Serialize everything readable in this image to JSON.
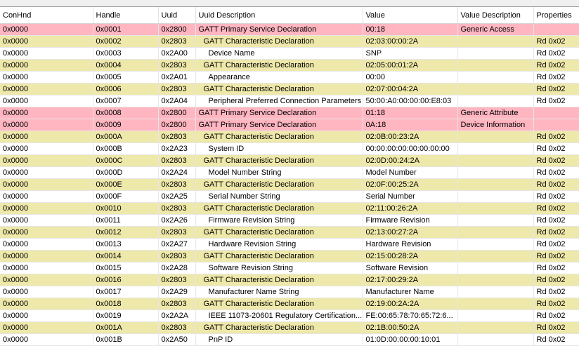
{
  "columns": [
    "ConHnd",
    "Handle",
    "Uuid",
    "Uuid Description",
    "Value",
    "Value Description",
    "Properties"
  ],
  "rows": [
    {
      "kind": "svc",
      "conhnd": "0x0000",
      "handle": "0x0001",
      "uuid": "0x2800",
      "desc": "GATT Primary Service Declaration",
      "value": "00:18",
      "value_desc": "Generic Access",
      "props": ""
    },
    {
      "kind": "chr",
      "conhnd": "0x0000",
      "handle": "0x0002",
      "uuid": "0x2803",
      "desc": "GATT Characteristic Declaration",
      "value": "02:03:00:00:2A",
      "value_desc": "",
      "props": "Rd  0x02"
    },
    {
      "kind": "val",
      "conhnd": "0x0000",
      "handle": "0x0003",
      "uuid": "0x2A00",
      "desc": "Device Name",
      "value": "SNP",
      "value_desc": "",
      "props": "Rd  0x02"
    },
    {
      "kind": "chr",
      "conhnd": "0x0000",
      "handle": "0x0004",
      "uuid": "0x2803",
      "desc": "GATT Characteristic Declaration",
      "value": "02:05:00:01:2A",
      "value_desc": "",
      "props": "Rd  0x02"
    },
    {
      "kind": "val",
      "conhnd": "0x0000",
      "handle": "0x0005",
      "uuid": "0x2A01",
      "desc": "Appearance",
      "value": "00:00",
      "value_desc": "",
      "props": "Rd  0x02"
    },
    {
      "kind": "chr",
      "conhnd": "0x0000",
      "handle": "0x0006",
      "uuid": "0x2803",
      "desc": "GATT Characteristic Declaration",
      "value": "02:07:00:04:2A",
      "value_desc": "",
      "props": "Rd  0x02"
    },
    {
      "kind": "val",
      "conhnd": "0x0000",
      "handle": "0x0007",
      "uuid": "0x2A04",
      "desc": "Peripheral Preferred Connection Parameters",
      "value": "50:00:A0:00:00:00:E8:03",
      "value_desc": "",
      "props": "Rd  0x02"
    },
    {
      "kind": "svc",
      "conhnd": "0x0000",
      "handle": "0x0008",
      "uuid": "0x2800",
      "desc": "GATT Primary Service Declaration",
      "value": "01:18",
      "value_desc": "Generic Attribute",
      "props": ""
    },
    {
      "kind": "svc",
      "conhnd": "0x0000",
      "handle": "0x0009",
      "uuid": "0x2800",
      "desc": "GATT Primary Service Declaration",
      "value": "0A:18",
      "value_desc": "Device Information",
      "props": ""
    },
    {
      "kind": "chr",
      "conhnd": "0x0000",
      "handle": "0x000A",
      "uuid": "0x2803",
      "desc": "GATT Characteristic Declaration",
      "value": "02:0B:00:23:2A",
      "value_desc": "",
      "props": "Rd  0x02"
    },
    {
      "kind": "val",
      "conhnd": "0x0000",
      "handle": "0x000B",
      "uuid": "0x2A23",
      "desc": "System ID",
      "value": "00:00:00:00:00:00:00:00",
      "value_desc": "",
      "props": "Rd  0x02"
    },
    {
      "kind": "chr",
      "conhnd": "0x0000",
      "handle": "0x000C",
      "uuid": "0x2803",
      "desc": "GATT Characteristic Declaration",
      "value": "02:0D:00:24:2A",
      "value_desc": "",
      "props": "Rd  0x02"
    },
    {
      "kind": "val",
      "conhnd": "0x0000",
      "handle": "0x000D",
      "uuid": "0x2A24",
      "desc": "Model Number String",
      "value": "Model Number",
      "value_desc": "",
      "props": "Rd  0x02"
    },
    {
      "kind": "chr",
      "conhnd": "0x0000",
      "handle": "0x000E",
      "uuid": "0x2803",
      "desc": "GATT Characteristic Declaration",
      "value": "02:0F:00:25:2A",
      "value_desc": "",
      "props": "Rd  0x02"
    },
    {
      "kind": "val",
      "conhnd": "0x0000",
      "handle": "0x000F",
      "uuid": "0x2A25",
      "desc": "Serial Number String",
      "value": "Serial Number",
      "value_desc": "",
      "props": "Rd  0x02"
    },
    {
      "kind": "chr",
      "conhnd": "0x0000",
      "handle": "0x0010",
      "uuid": "0x2803",
      "desc": "GATT Characteristic Declaration",
      "value": "02:11:00:26:2A",
      "value_desc": "",
      "props": "Rd  0x02"
    },
    {
      "kind": "val",
      "conhnd": "0x0000",
      "handle": "0x0011",
      "uuid": "0x2A26",
      "desc": "Firmware Revision String",
      "value": "Firmware Revision",
      "value_desc": "",
      "props": "Rd  0x02"
    },
    {
      "kind": "chr",
      "conhnd": "0x0000",
      "handle": "0x0012",
      "uuid": "0x2803",
      "desc": "GATT Characteristic Declaration",
      "value": "02:13:00:27:2A",
      "value_desc": "",
      "props": "Rd  0x02"
    },
    {
      "kind": "val",
      "conhnd": "0x0000",
      "handle": "0x0013",
      "uuid": "0x2A27",
      "desc": "Hardware Revision String",
      "value": "Hardware Revision",
      "value_desc": "",
      "props": "Rd  0x02"
    },
    {
      "kind": "chr",
      "conhnd": "0x0000",
      "handle": "0x0014",
      "uuid": "0x2803",
      "desc": "GATT Characteristic Declaration",
      "value": "02:15:00:28:2A",
      "value_desc": "",
      "props": "Rd  0x02"
    },
    {
      "kind": "val",
      "conhnd": "0x0000",
      "handle": "0x0015",
      "uuid": "0x2A28",
      "desc": "Software Revision String",
      "value": "Software Revision",
      "value_desc": "",
      "props": "Rd  0x02"
    },
    {
      "kind": "chr",
      "conhnd": "0x0000",
      "handle": "0x0016",
      "uuid": "0x2803",
      "desc": "GATT Characteristic Declaration",
      "value": "02:17:00:29:2A",
      "value_desc": "",
      "props": "Rd  0x02"
    },
    {
      "kind": "val",
      "conhnd": "0x0000",
      "handle": "0x0017",
      "uuid": "0x2A29",
      "desc": "Manufacturer Name String",
      "value": "Manufacturer Name",
      "value_desc": "",
      "props": "Rd  0x02"
    },
    {
      "kind": "chr",
      "conhnd": "0x0000",
      "handle": "0x0018",
      "uuid": "0x2803",
      "desc": "GATT Characteristic Declaration",
      "value": "02:19:00:2A:2A",
      "value_desc": "",
      "props": "Rd  0x02"
    },
    {
      "kind": "val",
      "conhnd": "0x0000",
      "handle": "0x0019",
      "uuid": "0x2A2A",
      "desc": "IEEE 11073-20601 Regulatory Certification...",
      "value": "FE:00:65:78:70:65:72:6...",
      "value_desc": "",
      "props": "Rd  0x02"
    },
    {
      "kind": "chr",
      "conhnd": "0x0000",
      "handle": "0x001A",
      "uuid": "0x2803",
      "desc": "GATT Characteristic Declaration",
      "value": "02:1B:00:50:2A",
      "value_desc": "",
      "props": "Rd  0x02"
    },
    {
      "kind": "val",
      "conhnd": "0x0000",
      "handle": "0x001B",
      "uuid": "0x2A50",
      "desc": "PnP ID",
      "value": "01:0D:00:00:00:10:01",
      "value_desc": "",
      "props": "Rd  0x02"
    }
  ],
  "colors": {
    "service_row": "#ffb6c1",
    "characteristic_row": "#eee8aa",
    "value_row": "#ffffff"
  }
}
